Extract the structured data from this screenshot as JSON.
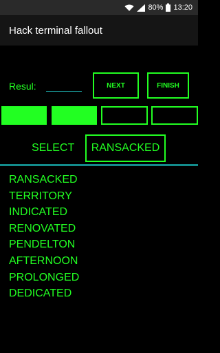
{
  "status_bar": {
    "battery_percent": "80%",
    "time": "13:20",
    "icons": [
      "wifi-icon",
      "signal-icon",
      "battery-icon"
    ]
  },
  "app_bar": {
    "title": "Hack terminal fallout"
  },
  "controls": {
    "result_label": "Resul:",
    "result_value": "",
    "next_label": "NEXT",
    "finish_label": "FINISH"
  },
  "slots": [
    {
      "filled": true
    },
    {
      "filled": true
    },
    {
      "filled": false
    },
    {
      "filled": false
    }
  ],
  "selection": {
    "label": "SELECT",
    "selected_word": "RANSACKED"
  },
  "words": [
    "RANSACKED",
    "TERRITORY",
    "INDICATED",
    "RENOVATED",
    "PENDELTON",
    "AFTERNOON",
    "PROLONGED",
    "DEDICATED"
  ],
  "colors": {
    "accent": "#22ff22",
    "divider": "#138c8c",
    "background": "#000000"
  }
}
